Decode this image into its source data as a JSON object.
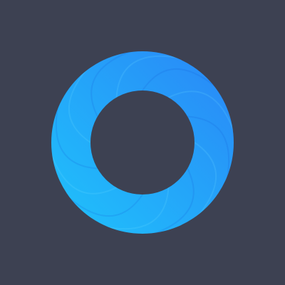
{
  "background_color": "#3d4152",
  "logo": {
    "icon": "ring-logo-icon",
    "colors": {
      "gradient_start": "#1fc3fb",
      "gradient_end": "#2a86f7",
      "blade_light": "#6fdcff",
      "blade_dark": "#1560d8",
      "hole": "#3d4152"
    },
    "blade_count": 12
  }
}
